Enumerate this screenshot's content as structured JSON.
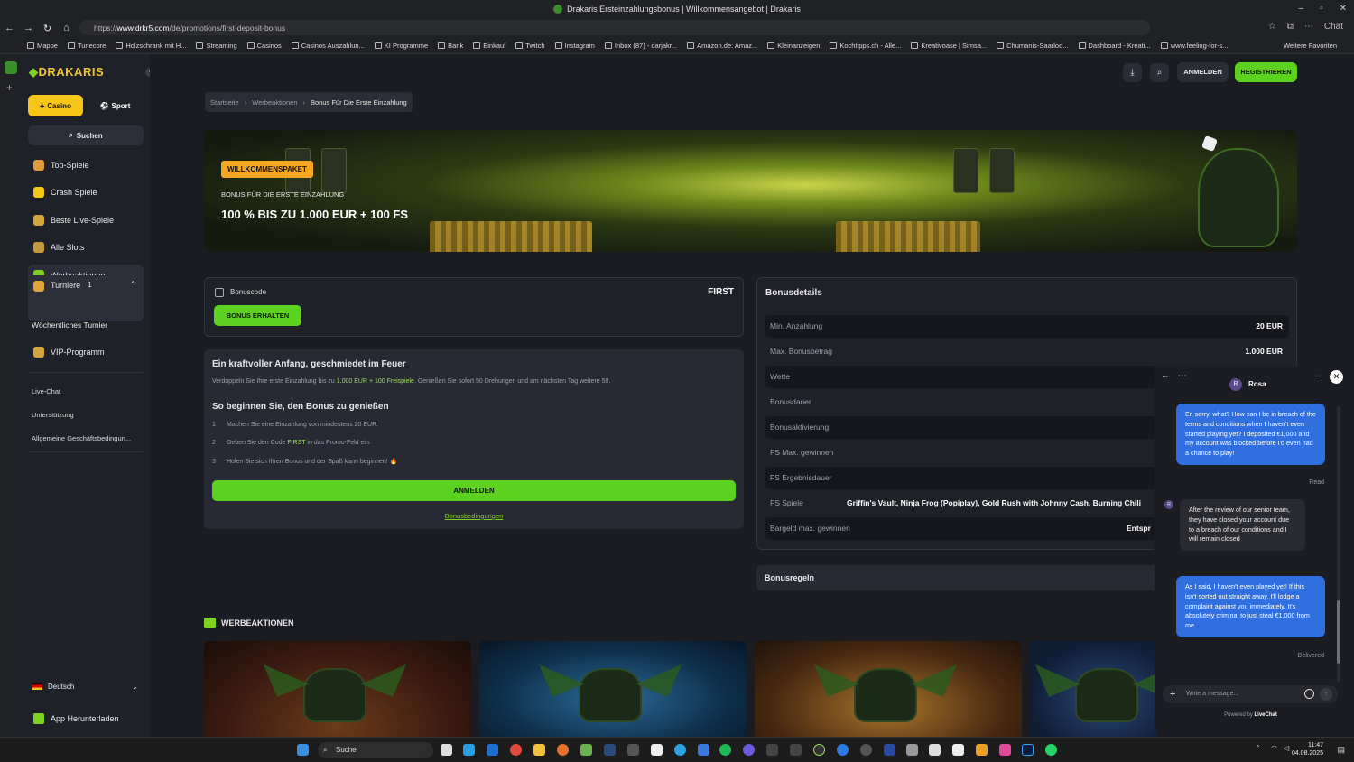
{
  "browser": {
    "title": "Drakaris Ersteinzahlungsbonus | Willkommensangebot | Drakaris",
    "url_prefix": "https://",
    "url_host": "www.drkr5.com",
    "url_path": "/de/promotions/first-deposit-bonus",
    "chat_label": "Chat",
    "bookmarks": [
      "Mappe",
      "Tunecore",
      "Holzschrank mit H...",
      "Streaming",
      "Casinos",
      "Casinos Auszahlun...",
      "KI Programme",
      "Bank",
      "Einkauf",
      "Twitch",
      "Instagram",
      "Inbox (87) - darjakr...",
      "Amazon.de: Amaz...",
      "Kleinanzeigen",
      "Kochtipps.ch - Alle...",
      "Kreativoase | Simsa...",
      "Chumanis-Saarloo...",
      "Dashboard - Kreati...",
      "www.feeling-for-s..."
    ],
    "more_favorites": "Weitere Favoriten"
  },
  "sidebar": {
    "logo_main": "DRAKARIS",
    "tab_casino": "Casino",
    "tab_sport": "Sport",
    "search": "Suchen",
    "items": [
      {
        "label": "Top-Spiele",
        "color": "#e09a3a"
      },
      {
        "label": "Crash Spiele",
        "color": "#f5c518"
      },
      {
        "label": "Beste Live-Spiele",
        "color": "#d4a53a"
      },
      {
        "label": "Alle Slots",
        "color": "#c49a3a"
      },
      {
        "label": "Werbeaktionen",
        "color": "#7ed321"
      },
      {
        "label": "Turniere",
        "color": "#e0a43a"
      }
    ],
    "tournament_badge": "1",
    "weekly_tournament": "Wöchentliches Turnier",
    "vip": "VIP-Programm",
    "links": [
      "Live-Chat",
      "Unterstützung",
      "Allgemeine Geschäftsbedingun..."
    ],
    "language": "Deutsch",
    "app_download": "App Herunterladen"
  },
  "header": {
    "login": "ANMELDEN",
    "register": "REGISTRIEREN"
  },
  "breadcrumb": [
    "Startseite",
    "Werbeaktionen",
    "Bonus Für Die Erste Einzahlung"
  ],
  "banner": {
    "tag": "WILLKOMMENSPAKET",
    "subtitle": "BONUS FÜR DIE ERSTE EINZAHLUNG",
    "title": "100 % BIS ZU 1.000 EUR + 100 FS"
  },
  "bonus_code": {
    "label": "Bonuscode",
    "code": "FIRST",
    "button": "BONUS ERHALTEN"
  },
  "info": {
    "title": "Ein kraftvoller Anfang, geschmiedet im Feuer",
    "text_a": "Verdoppeln Sie Ihre erste Einzahlung bis zu ",
    "text_hl": "1.000 EUR + 100 Freispiele",
    "text_b": ". Genießen Sie sofort 50 Drehungen und am nächsten Tag weitere 50.",
    "steps_title": "So beginnen Sie, den Bonus zu genießen",
    "step1_num": "1",
    "step1": "Machen Sie eine Einzahlung von mindestens 20 EUR.",
    "step2_num": "2",
    "step2_a": "Geben Sie den Code ",
    "step2_code": "FIRST",
    "step2_b": " in das Promo-Feld ein.",
    "step3_num": "3",
    "step3": "Holen Sie sich Ihren Bonus und der Spaß kann beginnen! 🔥",
    "button": "ANMELDEN",
    "terms_link": "Bonusbedingungen"
  },
  "details": {
    "title": "Bonusdetails",
    "rows": [
      {
        "label": "Min. Anzahlung",
        "value": "20 EUR"
      },
      {
        "label": "Max. Bonusbetrag",
        "value": "1.000 EUR"
      },
      {
        "label": "Wette",
        "value": ""
      },
      {
        "label": "Bonusdauer",
        "value": ""
      },
      {
        "label": "Bonusaktivierung",
        "value": ""
      },
      {
        "label": "FS Max. gewinnen",
        "value": ""
      },
      {
        "label": "FS Ergebnisdauer",
        "value": ""
      },
      {
        "label": "FS Spiele",
        "value": "Griffin's Vault, Ninja Frog (Popiplay), Gold Rush with Johnny Cash, Burning Chili"
      },
      {
        "label": "Bargeld max. gewinnen",
        "value": "Entspr"
      }
    ],
    "rules": "Bonusregeln"
  },
  "promotions": {
    "heading": "WERBEAKTIONEN"
  },
  "chat": {
    "agent_initial": "R",
    "agent_name": "Rosa",
    "msg1": "Er, sorry, what? How can I be in breach of the terms and conditions when I haven't even started playing yet? I deposited €1,000 and my account was blocked before I'd even had a chance to play!",
    "msg1_status": "Read",
    "msg2": "After the review of our senior team, they have closed your account due to a breach of our conditions and I will remain closed",
    "msg3": "As I said, I haven't even played yet! If this isn't sorted out straight away, I'll lodge a complaint against you immediately. It's absolutely criminal to just steal €1,000 from me",
    "msg3_status": "Delivered",
    "input_placeholder": "Write a message...",
    "powered_by": "Powered by",
    "powered_brand": "LiveChat"
  },
  "taskbar": {
    "search": "Suche",
    "time": "11:47",
    "date": "04.08.2025"
  }
}
